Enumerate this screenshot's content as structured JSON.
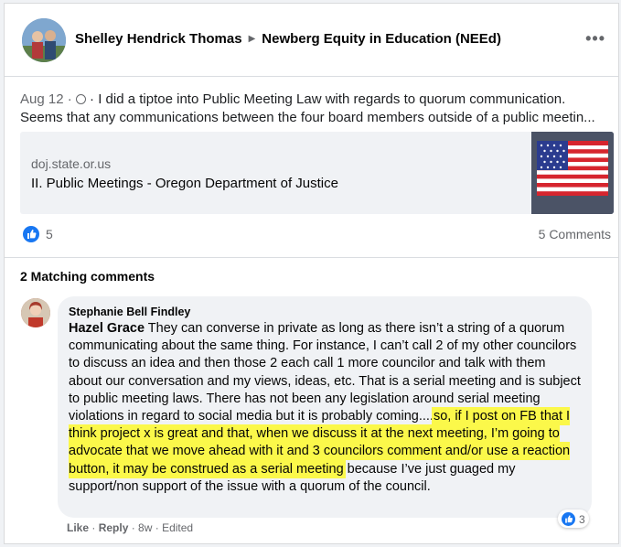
{
  "post": {
    "author": "Shelley Hendrick Thomas",
    "group": "Newberg Equity in Education (NEEd)",
    "more_label": "•••",
    "date": "Aug 12",
    "text_line1": " · I did a tiptoe into Public Meeting Law with regards to quorum communication.",
    "text_line2": "Seems that any communications between the four board members outside of a public meetin...",
    "link": {
      "domain": "doj.state.or.us",
      "title": "II. Public Meetings - Oregon Department of Justice"
    },
    "like_count": "5",
    "comments_count": "5 Comments"
  },
  "comments_section": {
    "title": "2 Matching comments"
  },
  "comment": {
    "author": "Stephanie Bell Findley",
    "mention": "Hazel Grace",
    "text_plain": " They can converse in private as long as there isn’t a string of a quorum communicating about the same thing. For instance, I can’t call 2 of my other councilors to discuss an idea and then those 2 each call 1 more councilor and talk with them about our conversation and my views, ideas, etc. That is a serial meeting and is subject to public meeting laws. There has not been any legislation around serial meeting violations in regard to social media but it is probably coming....",
    "text_highlight": "so, if I post on FB that I think project x is great and that, when we discuss it at the next meeting, I’m going to advocate that we move ahead with it and 3 councilors comment and/or use a reaction button, it may be construed as a serial meeting",
    "text_end": " because I’ve just guaged my support/non support of the issue with a quorum of the council.",
    "reaction_count": "3",
    "like_label": "Like",
    "reply_label": "Reply",
    "time": "8w",
    "edited_label": "Edited",
    "sep": " · "
  },
  "colors": {
    "accent": "#1877f2",
    "highlight": "#fbf84a",
    "secondary_text": "#65676b"
  }
}
